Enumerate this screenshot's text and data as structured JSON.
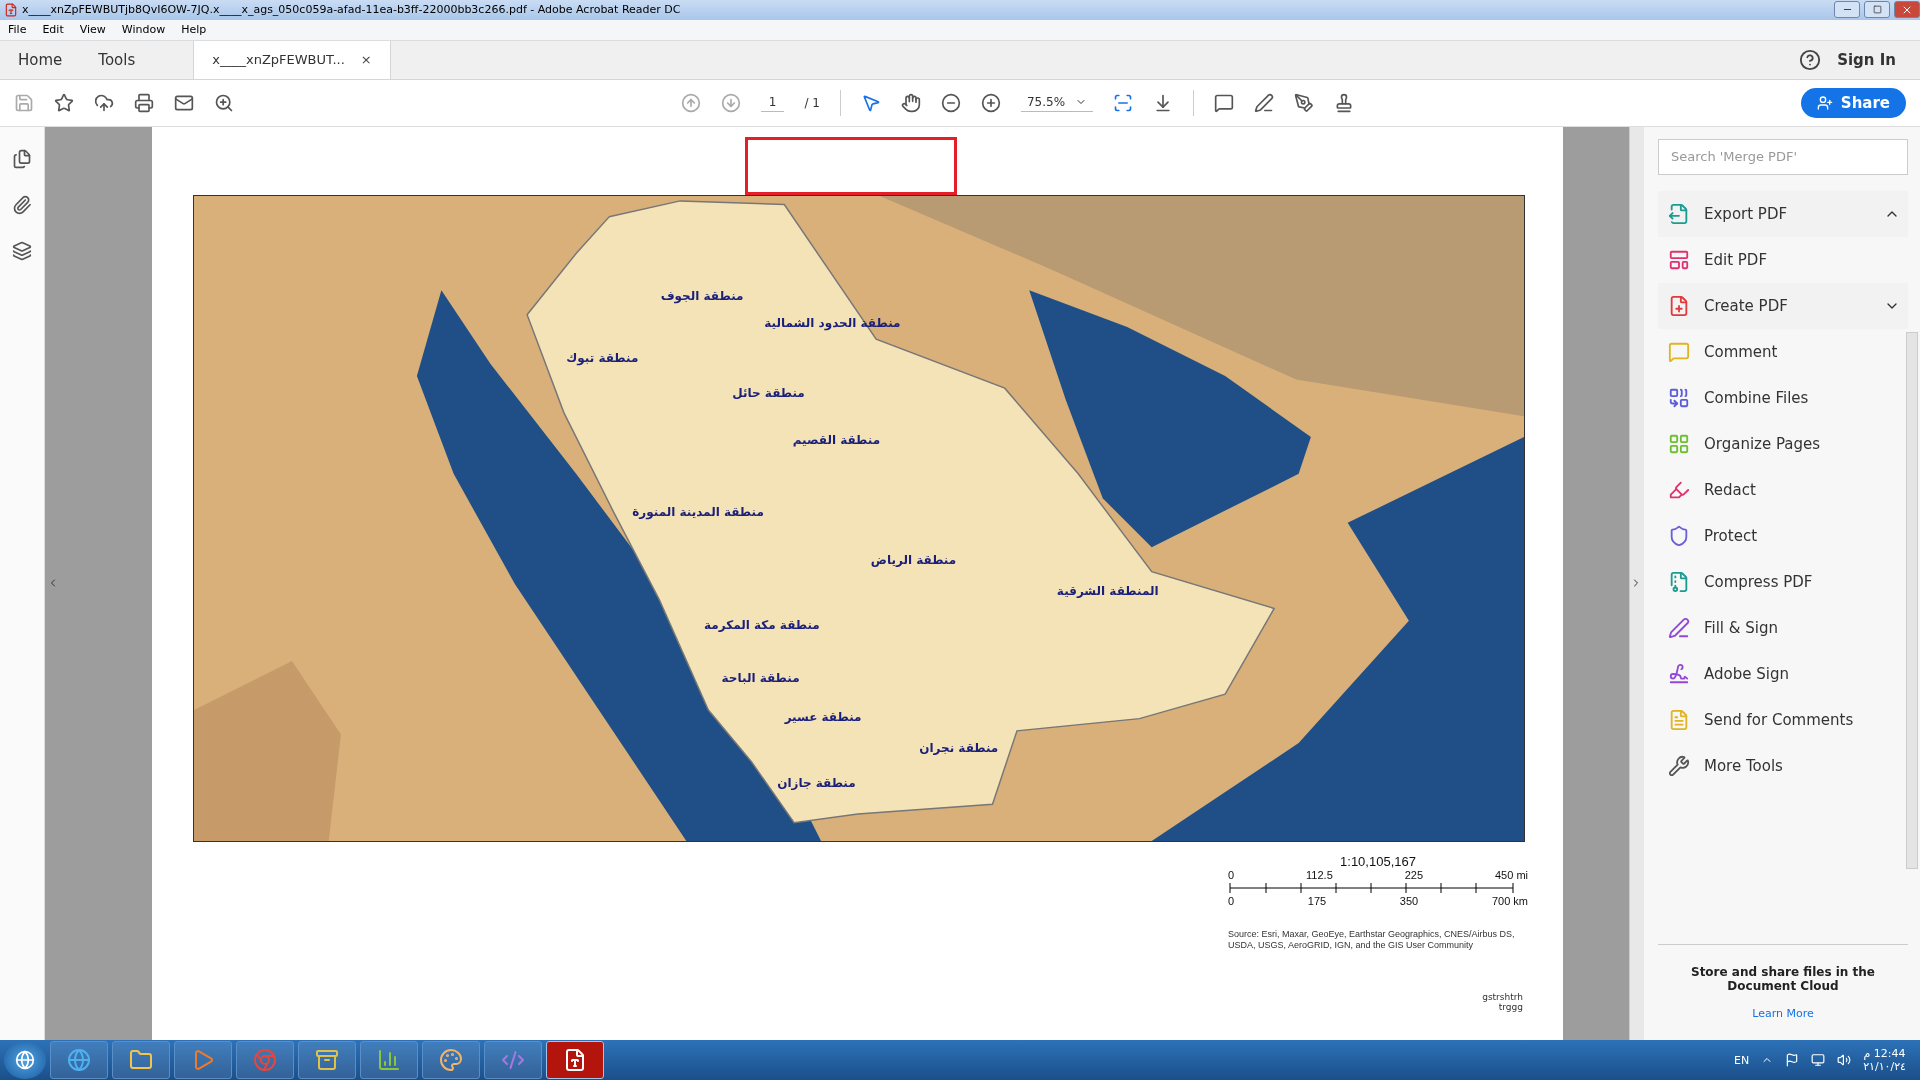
{
  "window": {
    "title": "x____xnZpFEWBUTjb8QvI6OW-7JQ.x____x_ags_050c059a-afad-11ea-b3ff-22000bb3c266.pdf - Adobe Acrobat Reader DC"
  },
  "menu": [
    "File",
    "Edit",
    "View",
    "Window",
    "Help"
  ],
  "tabs": [
    {
      "label": "Home",
      "selected": false,
      "kind": "nav"
    },
    {
      "label": "Tools",
      "selected": false,
      "kind": "nav"
    },
    {
      "label": "x____xnZpFEWBUT...",
      "selected": true,
      "kind": "document",
      "close": "×"
    }
  ],
  "sign_in": "Sign In",
  "toolbar": {
    "page": "1",
    "page_total": "/ 1",
    "zoom": "75.5%",
    "share": "Share"
  },
  "document": {
    "map_labels": [
      "منطقة الجوف",
      "منطقة الحدود الشمالية",
      "منطقة تبوك",
      "منطقة حائل",
      "منطقة القصيم",
      "منطقة المدينة المنورة",
      "منطقة الرياض",
      "المنطقة الشرقية",
      "منطقة مكة المكرمة",
      "منطقة الباحة",
      "منطقة عسير",
      "منطقة نجران",
      "منطقة جازان"
    ],
    "scale": "1:10,105,167",
    "miles": [
      "0",
      "112.5",
      "225",
      "450 mi"
    ],
    "kilometres": [
      "0",
      "175",
      "350",
      "700 km"
    ],
    "source": "Source: Esri, Maxar, GeoEye, Earthstar Geographics, CNES/Airbus DS, USDA, USGS, AeroGRID, IGN, and the GIS User Community",
    "notes": [
      "gstrshtrh",
      "trggg"
    ]
  },
  "tools_panel": {
    "search": {
      "placeholder": "Search 'Merge PDF'"
    },
    "items": [
      {
        "label": "Export PDF",
        "color": "#1a9c8f",
        "expanded": true
      },
      {
        "label": "Edit PDF",
        "color": "#e0306f"
      },
      {
        "label": "Create PDF",
        "color": "#e0393e",
        "expanded": false
      },
      {
        "label": "Comment",
        "color": "#e0b422"
      },
      {
        "label": "Combine Files",
        "color": "#5b5bdc"
      },
      {
        "label": "Organize Pages",
        "color": "#6cbf2e"
      },
      {
        "label": "Redact",
        "color": "#e0306f"
      },
      {
        "label": "Protect",
        "color": "#6a5fd8"
      },
      {
        "label": "Compress PDF",
        "color": "#1a9c8f"
      },
      {
        "label": "Fill & Sign",
        "color": "#9447d6"
      },
      {
        "label": "Adobe Sign",
        "color": "#9447d6"
      },
      {
        "label": "Send for Comments",
        "color": "#e0b422"
      },
      {
        "label": "More Tools",
        "color": "#555555"
      }
    ],
    "promo": "Store and share files in the Document Cloud",
    "link": "Learn More"
  },
  "taskbar": {
    "apps": [
      {
        "kind": "browser",
        "selected": false
      },
      {
        "kind": "folder",
        "selected": false
      },
      {
        "kind": "media",
        "selected": false
      },
      {
        "kind": "chrome",
        "selected": false
      },
      {
        "kind": "cabinet",
        "selected": false
      },
      {
        "kind": "chart",
        "selected": false
      },
      {
        "kind": "paint",
        "selected": false
      },
      {
        "kind": "studio",
        "selected": false
      },
      {
        "kind": "acrobat",
        "selected": true
      }
    ],
    "language": "EN",
    "time": "12:44 م",
    "date": "٢١/١٠/٢٤"
  }
}
